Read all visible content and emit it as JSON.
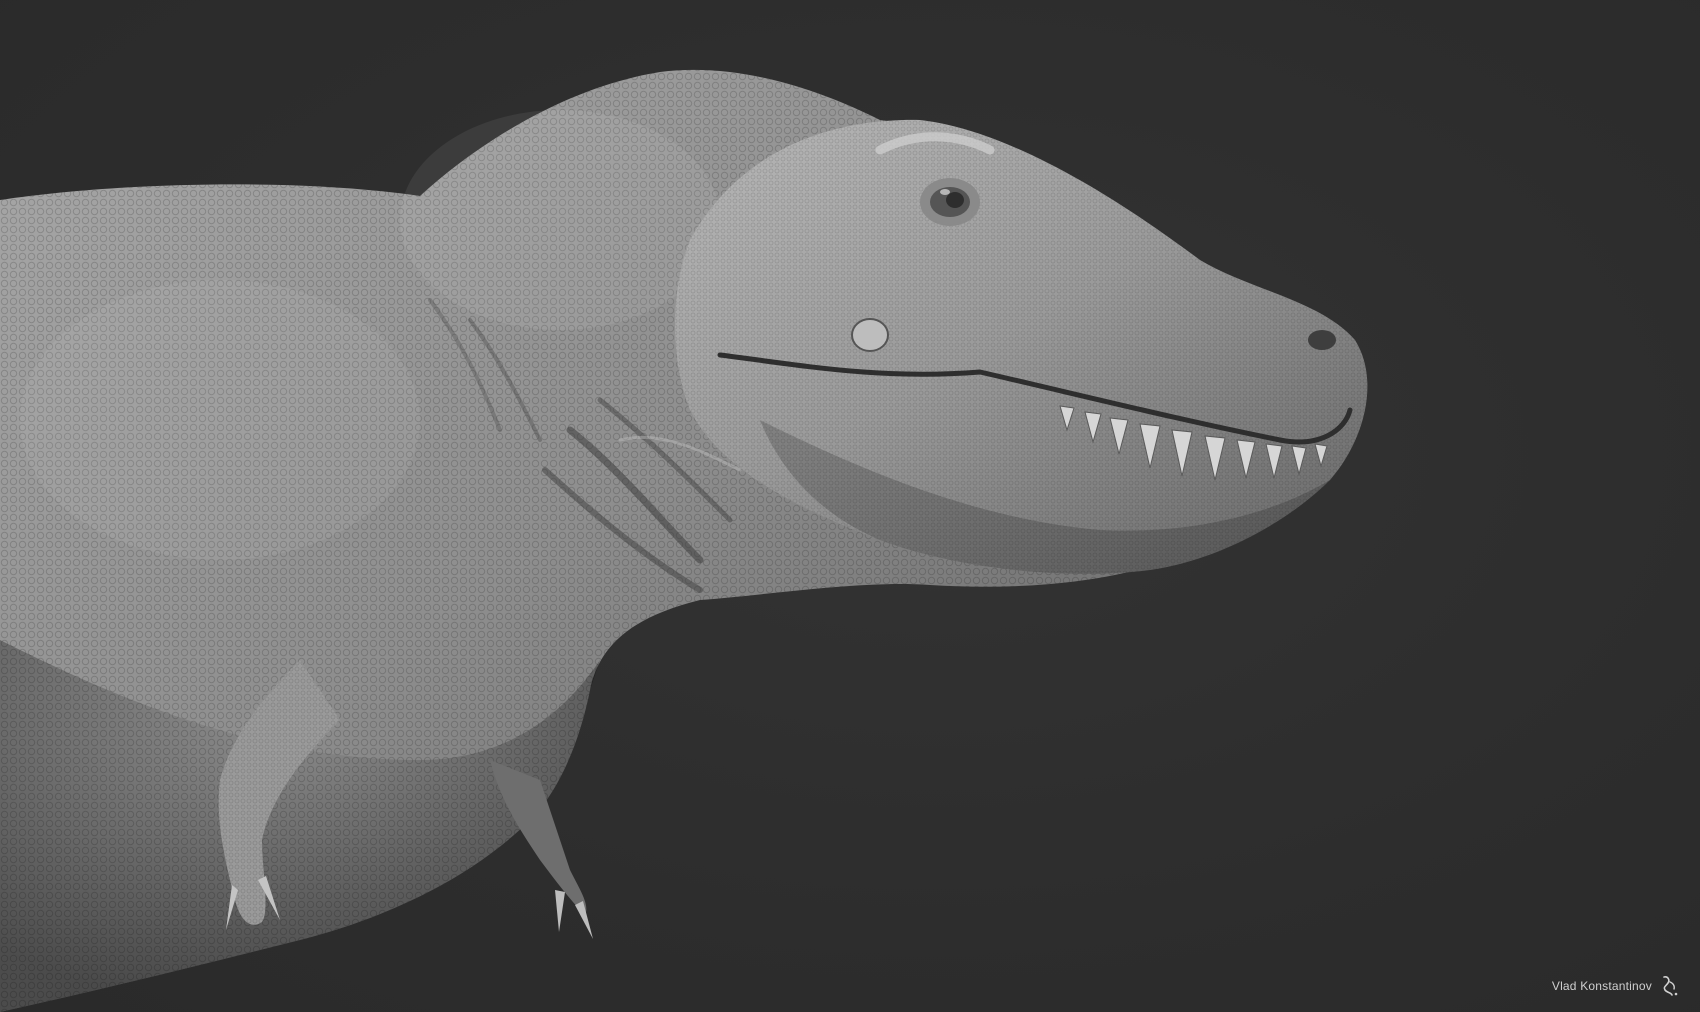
{
  "image": {
    "subject": "t-rex-sculpt",
    "background_color": "#2e2e2e",
    "skin_base": "#9a9a9a",
    "skin_highlight": "#c9c9c9",
    "skin_shadow": "#4a4a4a"
  },
  "signature": {
    "author_text": "Vlad Konstantinov",
    "mark_icon": "author-logo-icon"
  }
}
